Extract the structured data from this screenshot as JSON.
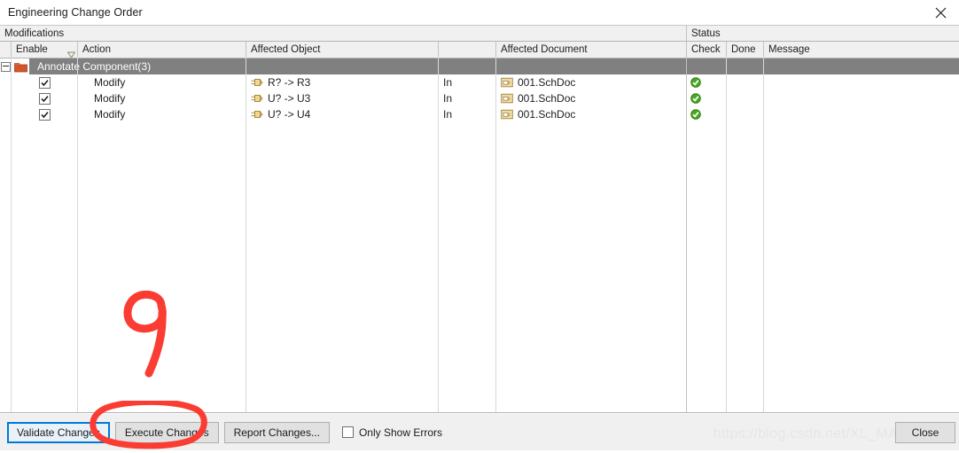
{
  "window": {
    "title": "Engineering Change Order",
    "close_icon": "close-icon"
  },
  "grid": {
    "group_headers": [
      {
        "label": "Modifications"
      },
      {
        "label": "Status"
      }
    ],
    "columns": [
      {
        "label": ""
      },
      {
        "label": "Enable"
      },
      {
        "label": "Action"
      },
      {
        "label": "Affected Object"
      },
      {
        "label": ""
      },
      {
        "label": "Affected Document"
      },
      {
        "label": "Check"
      },
      {
        "label": "Done"
      },
      {
        "label": "Message"
      }
    ],
    "group_row": {
      "label": "Annotate Component(3)",
      "expanded": "−",
      "folder_icon": "folder-icon",
      "selected": true
    },
    "rows": [
      {
        "enabled": "✓",
        "action": "Modify",
        "object": "R? -> R3",
        "object_icon": "component-icon",
        "inout": "In",
        "document": "001.SchDoc",
        "document_icon": "schematic-document-icon",
        "check": "ok",
        "done": "",
        "message": ""
      },
      {
        "enabled": "✓",
        "action": "Modify",
        "object": "U? -> U3",
        "object_icon": "component-icon",
        "inout": "In",
        "document": "001.SchDoc",
        "document_icon": "schematic-document-icon",
        "check": "ok",
        "done": "",
        "message": ""
      },
      {
        "enabled": "✓",
        "action": "Modify",
        "object": "U? -> U4",
        "object_icon": "component-icon",
        "inout": "In",
        "document": "001.SchDoc",
        "document_icon": "schematic-document-icon",
        "check": "ok",
        "done": "",
        "message": ""
      }
    ]
  },
  "footer": {
    "validate_label": "Validate Changes",
    "execute_label": "Execute Changes",
    "report_label": "Report Changes...",
    "only_show_errors_label": "Only Show Errors",
    "only_show_errors_checked": false,
    "close_label": "Close"
  },
  "watermark": {
    "text": "https://blog.csdn.net/XL_MAX"
  },
  "annotations": {
    "color": "#fa3c32",
    "number_mark": "9",
    "circled_target": "Execute Changes"
  }
}
